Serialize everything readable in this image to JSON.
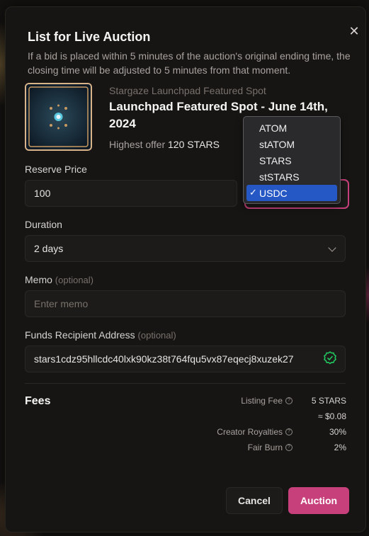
{
  "modal": {
    "title": "List for Live Auction",
    "subtitle": "If a bid is placed within 5 minutes of the auction's original ending time, the closing time will be adjusted to 5 minutes from that moment.",
    "close_icon": "close-icon"
  },
  "nft": {
    "collection": "Stargaze Launchpad Featured Spot",
    "name": "Launchpad Featured Spot - June 14th, 2024",
    "offer_label": "Highest offer",
    "offer_value": "120 STARS"
  },
  "reserve_price": {
    "label": "Reserve Price",
    "value": "100"
  },
  "currency": {
    "options": [
      "ATOM",
      "stATOM",
      "STARS",
      "stSTARS",
      "USDC"
    ],
    "selected": "USDC",
    "check": "✓"
  },
  "duration": {
    "label": "Duration",
    "value": "2 days"
  },
  "memo": {
    "label": "Memo",
    "optional": "(optional)",
    "placeholder": "Enter memo"
  },
  "recipient": {
    "label": "Funds Recipient Address",
    "optional": "(optional)",
    "value": "stars1cdz95hllcdc40lxk90kz38t764fqu5vx87eqecj8xuzek27"
  },
  "fees": {
    "title": "Fees",
    "listing_label": "Listing Fee",
    "listing_value": "5 STARS",
    "listing_usd": "≈ $0.08",
    "royalties_label": "Creator Royalties",
    "royalties_value": "30%",
    "burn_label": "Fair Burn",
    "burn_value": "2%"
  },
  "actions": {
    "cancel": "Cancel",
    "auction": "Auction"
  },
  "colors": {
    "accent": "#c8407b",
    "selection": "#2557c5",
    "verified": "#22c55e"
  }
}
